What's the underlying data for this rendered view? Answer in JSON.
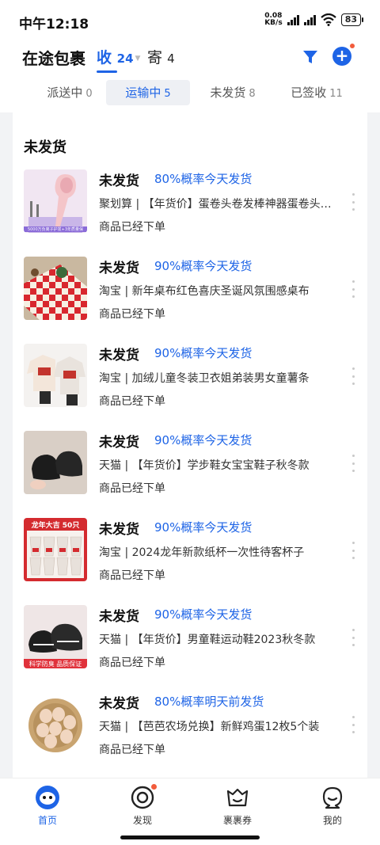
{
  "status_bar": {
    "time": "中午12:18",
    "net_speed_value": "0.08",
    "net_speed_unit": "KB/s",
    "battery": "83"
  },
  "header": {
    "title": "在途包裹",
    "tab_receive_label": "收",
    "tab_receive_count": "24",
    "tab_send_label": "寄",
    "tab_send_count": "4"
  },
  "subtabs": [
    {
      "label": "派送中",
      "count": "0"
    },
    {
      "label": "运输中",
      "count": "5"
    },
    {
      "label": "未发货",
      "count": "8"
    },
    {
      "label": "已签收",
      "count": "11"
    }
  ],
  "section_title": "未发货",
  "items": [
    {
      "status": "未发货",
      "probability": "80%概率今天发货",
      "description": "聚划算 | 【年货价】蛋卷头卷发棒神器蛋卷头卷发棒神器",
      "sub": "商品已经下单",
      "thumb_icon": "curling-iron-product-icon"
    },
    {
      "status": "未发货",
      "probability": "90%概率今天发货",
      "description": "淘宝 | 新年桌布红色喜庆圣诞风氛围感桌布",
      "sub": "商品已经下单",
      "thumb_icon": "tablecloth-product-icon"
    },
    {
      "status": "未发货",
      "probability": "90%概率今天发货",
      "description": "淘宝 | 加绒儿童冬装卫衣姐弟装男女童薯条",
      "sub": "商品已经下单",
      "thumb_icon": "kids-sweater-product-icon"
    },
    {
      "status": "未发货",
      "probability": "90%概率今天发货",
      "description": "天猫 | 【年货价】学步鞋女宝宝鞋子秋冬款",
      "sub": "商品已经下单",
      "thumb_icon": "baby-shoes-product-icon"
    },
    {
      "status": "未发货",
      "probability": "90%概率今天发货",
      "description": "淘宝 | 2024龙年新款纸杯一次性待客杯子",
      "sub": "商品已经下单",
      "thumb_icon": "paper-cups-product-icon"
    },
    {
      "status": "未发货",
      "probability": "90%概率今天发货",
      "description": "天猫 | 【年货价】男童鞋运动鞋2023秋冬款",
      "sub": "商品已经下单",
      "thumb_icon": "kids-sneakers-product-icon"
    },
    {
      "status": "未发货",
      "probability": "80%概率明天前发货",
      "description": "天猫 | 【芭芭农场兑换】新鲜鸡蛋12枚5个装",
      "sub": "商品已经下单",
      "thumb_icon": "eggs-product-icon"
    }
  ],
  "thumb_texts": {
    "cups_banner": "龙年大吉 50只",
    "curling_banner": "5000万负离子护发+3年质量保",
    "sneakers_banner": "科学防臭 品质保证"
  },
  "bottom_nav": [
    {
      "label": "首页",
      "icon": "home-icon",
      "active": true
    },
    {
      "label": "发现",
      "icon": "discover-icon",
      "active": false
    },
    {
      "label": "裹裹券",
      "icon": "coupon-icon",
      "active": false
    },
    {
      "label": "我的",
      "icon": "profile-icon",
      "active": false
    }
  ],
  "colors": {
    "accent": "#1e64e6",
    "badge": "#f25c3c"
  }
}
